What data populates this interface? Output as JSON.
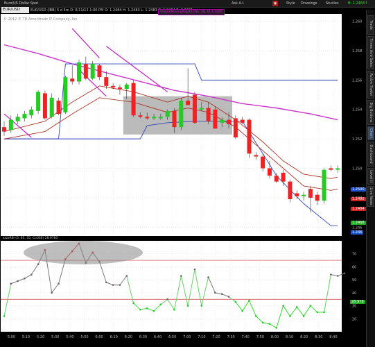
{
  "topbar": {
    "symbol_dropdown": "Euro/US Dollar Spot",
    "menu_items": [
      "Ask A.I.",
      "Style",
      "Drawings",
      "Studies"
    ],
    "quote": "B: 1.2484↑"
  },
  "infobar": {
    "symbol": "EUR/USD",
    "ticker_text": "EUR/USD (IBB) 5 d 5m  D: 6/11/12 1:00 PM  O: 1.2484  H: 1.2483  L: 1.2483  C: 1.2484  R: 0.0001",
    "overlay_label": "SimpleMovingAvg(CLOSE, 50, 0)  1.2485",
    "watermark": "© 2012 ® TD Ameritrade IP Company, Inc."
  },
  "sidebar_tabs": [
    "Trade",
    "Times And Sales",
    "Active Trader",
    "Big Buttons",
    "Chart",
    "Dashboard",
    "Level II",
    "Live News"
  ],
  "price_pills": [
    {
      "label": "1.2500",
      "color": "#2255cc"
    },
    {
      "label": "1.2490",
      "color": "#cc2222"
    },
    {
      "label": "1.2484",
      "color": "#cc2222"
    },
    {
      "label": "1.2468",
      "color": "#22aa22"
    },
    {
      "label": "1.246",
      "color": "#2255cc"
    }
  ],
  "rsi_label": "zzzzRSI (5, 65, 35, CLOSE)  28.9783",
  "rsi_value_pill": "28.978",
  "chart_data": [
    {
      "type": "candlestick",
      "title": "EUR/USD",
      "x_tick_labels": [
        "5:00",
        "5:10",
        "5:20",
        "5:30",
        "5:40",
        "5:50",
        "6:00",
        "6:10",
        "6:20",
        "6:30",
        "6:40",
        "6:50",
        "7:00",
        "7:10",
        "7:20",
        "7:30",
        "7:40",
        "7:50",
        "8:00",
        "8:10",
        "8:20",
        "8:30",
        "8:40"
      ],
      "y_tick_labels": [
        "1.260",
        "1.258",
        "1.256",
        "1.254",
        "1.252",
        "1.250",
        "1.248",
        "1.246"
      ],
      "ylim": [
        1.2454,
        1.2605
      ],
      "candles": [
        {
          "o": 1.2528,
          "h": 1.2532,
          "l": 1.2522,
          "c": 1.2525
        },
        {
          "o": 1.2526,
          "h": 1.2536,
          "l": 1.2524,
          "c": 1.2533
        },
        {
          "o": 1.2532,
          "h": 1.2537,
          "l": 1.253,
          "c": 1.2535
        },
        {
          "o": 1.2534,
          "h": 1.2539,
          "l": 1.2532,
          "c": 1.2537
        },
        {
          "o": 1.2536,
          "h": 1.2542,
          "l": 1.2534,
          "c": 1.254
        },
        {
          "o": 1.2539,
          "h": 1.2553,
          "l": 1.2537,
          "c": 1.2552
        },
        {
          "o": 1.2551,
          "h": 1.2553,
          "l": 1.2533,
          "c": 1.2534
        },
        {
          "o": 1.2535,
          "h": 1.2551,
          "l": 1.2534,
          "c": 1.2548
        },
        {
          "o": 1.2546,
          "h": 1.2548,
          "l": 1.2536,
          "c": 1.2537
        },
        {
          "o": 1.2538,
          "h": 1.2563,
          "l": 1.2537,
          "c": 1.2562
        },
        {
          "o": 1.2561,
          "h": 1.257,
          "l": 1.2557,
          "c": 1.2559
        },
        {
          "o": 1.2559,
          "h": 1.2574,
          "l": 1.2557,
          "c": 1.2572
        },
        {
          "o": 1.2571,
          "h": 1.2576,
          "l": 1.256,
          "c": 1.2561
        },
        {
          "o": 1.2561,
          "h": 1.2573,
          "l": 1.256,
          "c": 1.2571
        },
        {
          "o": 1.257,
          "h": 1.2571,
          "l": 1.256,
          "c": 1.2562
        },
        {
          "o": 1.2562,
          "h": 1.2566,
          "l": 1.2554,
          "c": 1.2556
        },
        {
          "o": 1.2556,
          "h": 1.2558,
          "l": 1.2554,
          "c": 1.2555
        },
        {
          "o": 1.2555,
          "h": 1.2557,
          "l": 1.255,
          "c": 1.2554
        },
        {
          "o": 1.2554,
          "h": 1.2558,
          "l": 1.2547,
          "c": 1.2557
        },
        {
          "o": 1.2558,
          "h": 1.256,
          "l": 1.2535,
          "c": 1.2536
        },
        {
          "o": 1.2536,
          "h": 1.2538,
          "l": 1.2534,
          "c": 1.2535
        },
        {
          "o": 1.2535,
          "h": 1.2538,
          "l": 1.2533,
          "c": 1.2534
        },
        {
          "o": 1.2534,
          "h": 1.2537,
          "l": 1.2533,
          "c": 1.2535
        },
        {
          "o": 1.2534,
          "h": 1.2537,
          "l": 1.2533,
          "c": 1.2535
        },
        {
          "o": 1.2535,
          "h": 1.254,
          "l": 1.2533,
          "c": 1.2539
        },
        {
          "o": 1.2539,
          "h": 1.2541,
          "l": 1.2524,
          "c": 1.2528
        },
        {
          "o": 1.2528,
          "h": 1.2548,
          "l": 1.2526,
          "c": 1.2546
        },
        {
          "o": 1.2546,
          "h": 1.2568,
          "l": 1.2543,
          "c": 1.2543
        },
        {
          "o": 1.255,
          "h": 1.2552,
          "l": 1.253,
          "c": 1.2531
        },
        {
          "o": 1.254,
          "h": 1.2545,
          "l": 1.2539,
          "c": 1.2541
        },
        {
          "o": 1.2541,
          "h": 1.2545,
          "l": 1.253,
          "c": 1.2532
        },
        {
          "o": 1.254,
          "h": 1.2542,
          "l": 1.2527,
          "c": 1.2527
        },
        {
          "o": 1.2531,
          "h": 1.2535,
          "l": 1.2528,
          "c": 1.2533
        },
        {
          "o": 1.2533,
          "h": 1.2538,
          "l": 1.2527,
          "c": 1.253
        },
        {
          "o": 1.2534,
          "h": 1.2536,
          "l": 1.252,
          "c": 1.2521
        },
        {
          "o": 1.2533,
          "h": 1.2535,
          "l": 1.253,
          "c": 1.2531
        },
        {
          "o": 1.2533,
          "h": 1.2534,
          "l": 1.2507,
          "c": 1.251
        },
        {
          "o": 1.2509,
          "h": 1.2511,
          "l": 1.2506,
          "c": 1.2508
        },
        {
          "o": 1.2508,
          "h": 1.251,
          "l": 1.2498,
          "c": 1.25
        },
        {
          "o": 1.25,
          "h": 1.2505,
          "l": 1.2493,
          "c": 1.2495
        },
        {
          "o": 1.2495,
          "h": 1.2497,
          "l": 1.249,
          "c": 1.2491
        },
        {
          "o": 1.2497,
          "h": 1.2499,
          "l": 1.2488,
          "c": 1.2491
        },
        {
          "o": 1.2491,
          "h": 1.2492,
          "l": 1.2477,
          "c": 1.2479
        },
        {
          "o": 1.2483,
          "h": 1.2485,
          "l": 1.2479,
          "c": 1.2481
        },
        {
          "o": 1.2481,
          "h": 1.2484,
          "l": 1.2478,
          "c": 1.2482
        },
        {
          "o": 1.2486,
          "h": 1.2488,
          "l": 1.247,
          "c": 1.248
        },
        {
          "o": 1.2482,
          "h": 1.2484,
          "l": 1.2475,
          "c": 1.2478
        },
        {
          "o": 1.2478,
          "h": 1.25,
          "l": 1.2476,
          "c": 1.2499
        },
        {
          "o": 1.25,
          "h": 1.2502,
          "l": 1.2498,
          "c": 1.2499
        },
        {
          "o": 1.2499,
          "h": 1.2502,
          "l": 1.2497,
          "c": 1.25
        }
      ],
      "overlay_series": [
        {
          "color": "#cc33cc",
          "values": [
            [
              0,
              1.2584
            ],
            [
              5,
              1.2578
            ],
            [
              10,
              1.2571
            ],
            [
              15,
              1.2565
            ],
            [
              20,
              1.2559
            ],
            [
              25,
              1.2553
            ],
            [
              30,
              1.2549
            ],
            [
              35,
              1.2544
            ],
            [
              40,
              1.2541
            ],
            [
              45,
              1.2537
            ],
            [
              49,
              1.2533
            ]
          ]
        },
        {
          "color": "#3344bb",
          "values": [
            [
              0,
              1.252
            ],
            [
              8,
              1.252
            ],
            [
              9,
              1.2571
            ],
            [
              28,
              1.2571
            ],
            [
              29,
              1.256
            ],
            [
              49,
              1.256
            ]
          ]
        },
        {
          "color": "#3344bb",
          "values": [
            [
              0,
              1.252
            ],
            [
              20,
              1.252
            ],
            [
              21,
              1.2529
            ],
            [
              24,
              1.2531
            ],
            [
              28,
              1.2532
            ],
            [
              35,
              1.2532
            ],
            [
              38,
              1.251
            ],
            [
              40,
              1.2495
            ],
            [
              44,
              1.2476
            ],
            [
              48,
              1.2461
            ],
            [
              49,
              1.2461
            ]
          ]
        },
        {
          "color": "#aa3322",
          "values": [
            [
              0,
              1.2525
            ],
            [
              6,
              1.2532
            ],
            [
              10,
              1.2545
            ],
            [
              14,
              1.2556
            ],
            [
              19,
              1.2552
            ],
            [
              24,
              1.2545
            ],
            [
              27,
              1.2549
            ],
            [
              30,
              1.2545
            ],
            [
              34,
              1.2533
            ],
            [
              38,
              1.2518
            ],
            [
              41,
              1.2505
            ],
            [
              44,
              1.2496
            ],
            [
              48,
              1.2493
            ],
            [
              49,
              1.2494
            ]
          ]
        },
        {
          "color": "#aa3322",
          "values": [
            [
              0,
              1.252
            ],
            [
              6,
              1.2525
            ],
            [
              10,
              1.2537
            ],
            [
              14,
              1.2548
            ],
            [
              19,
              1.2545
            ],
            [
              24,
              1.2538
            ],
            [
              27,
              1.2541
            ],
            [
              30,
              1.2538
            ],
            [
              34,
              1.2528
            ],
            [
              38,
              1.2512
            ],
            [
              41,
              1.25
            ],
            [
              44,
              1.2488
            ],
            [
              48,
              1.2485
            ],
            [
              49,
              1.2486
            ]
          ]
        }
      ],
      "trend_lines": [
        {
          "color": "#bb22bb",
          "from": [
            0,
            1.2537
          ],
          "to": [
            4,
            1.2521
          ]
        },
        {
          "color": "#bb22bb",
          "from": [
            10,
            1.2595
          ],
          "to": [
            14,
            1.2575
          ]
        },
        {
          "color": "#bb22bb",
          "from": [
            15,
            1.2583
          ],
          "to": [
            24,
            1.2552
          ]
        },
        {
          "color": "#bb22bb",
          "from": [
            11,
            1.2567
          ],
          "to": [
            15,
            1.2549
          ]
        }
      ],
      "box": {
        "x_from": 17.5,
        "x_to": 33.5,
        "y_from": 1.2523,
        "y_to": 1.2549,
        "color": "#aaaaaa"
      }
    },
    {
      "type": "line",
      "title": "zzzzRSI (5, 65, 35, CLOSE)",
      "y_tick_labels": [
        "70",
        "60",
        "50",
        "40",
        "30",
        "20"
      ],
      "ylim": [
        10,
        80
      ],
      "overbought": 65,
      "oversold": 35,
      "values": [
        22,
        47,
        49,
        51,
        54,
        62,
        73,
        40,
        47,
        66,
        72,
        78,
        63,
        71,
        64,
        48,
        46,
        46,
        53,
        32,
        27,
        28,
        26,
        31,
        35,
        27,
        53,
        30,
        58,
        30,
        52,
        40,
        39,
        37,
        33,
        26,
        34,
        22,
        17,
        16,
        13,
        30,
        22,
        29,
        22,
        30,
        25,
        25,
        54,
        53,
        55
      ]
    }
  ]
}
